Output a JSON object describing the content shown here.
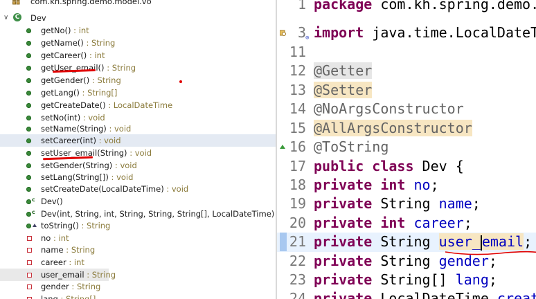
{
  "outline": {
    "items": [
      {
        "label": "com.kh.spring.demo.model.vo",
        "type": "",
        "kind": "package"
      },
      {
        "label": "Dev",
        "type": "",
        "kind": "class"
      },
      {
        "label": "getNo()",
        "type": "int",
        "kind": "method"
      },
      {
        "label": "getName()",
        "type": "String",
        "kind": "method"
      },
      {
        "label": "getCareer()",
        "type": "int",
        "kind": "method"
      },
      {
        "label": "getUser_email()",
        "type": "String",
        "kind": "method"
      },
      {
        "label": "getGender()",
        "type": "String",
        "kind": "method"
      },
      {
        "label": "getLang()",
        "type": "String[]",
        "kind": "method"
      },
      {
        "label": "getCreateDate()",
        "type": "LocalDateTime",
        "kind": "method"
      },
      {
        "label": "setNo(int)",
        "type": "void",
        "kind": "method"
      },
      {
        "label": "setName(String)",
        "type": "void",
        "kind": "method"
      },
      {
        "label": "setCareer(int)",
        "type": "void",
        "kind": "method"
      },
      {
        "label": "setUser_email(String)",
        "type": "void",
        "kind": "method"
      },
      {
        "label": "setGender(String)",
        "type": "void",
        "kind": "method"
      },
      {
        "label": "setLang(String[])",
        "type": "void",
        "kind": "method"
      },
      {
        "label": "setCreateDate(LocalDateTime)",
        "type": "void",
        "kind": "method"
      },
      {
        "label": "Dev()",
        "type": "",
        "kind": "constructor"
      },
      {
        "label": "Dev(int, String, int, String, String, String[], LocalDateTime)",
        "type": "",
        "kind": "constructor"
      },
      {
        "label": "toString()",
        "type": "String",
        "kind": "override"
      },
      {
        "label": "no",
        "type": "int",
        "kind": "field"
      },
      {
        "label": "name",
        "type": "String",
        "kind": "field"
      },
      {
        "label": "career",
        "type": "int",
        "kind": "field"
      },
      {
        "label": "user_email",
        "type": "String",
        "kind": "field"
      },
      {
        "label": "gender",
        "type": "String",
        "kind": "field"
      },
      {
        "label": "lang",
        "type": "String[]",
        "kind": "field"
      }
    ]
  },
  "editor": {
    "lines": [
      {
        "num": "1",
        "text": "package com.kh.spring.demo.model.vo;"
      },
      {
        "num": "3",
        "text": "import java.time.LocalDateTime;"
      },
      {
        "num": "11",
        "text": ""
      },
      {
        "num": "12",
        "text": "@Getter"
      },
      {
        "num": "13",
        "text": "@Setter"
      },
      {
        "num": "14",
        "text": "@NoArgsConstructor"
      },
      {
        "num": "15",
        "text": "@AllArgsConstructor"
      },
      {
        "num": "16",
        "text": "@ToString"
      },
      {
        "num": "17",
        "text": "public class Dev {"
      },
      {
        "num": "18",
        "text": "private int no;"
      },
      {
        "num": "19",
        "text": "private String name;"
      },
      {
        "num": "20",
        "text": "private int career;"
      },
      {
        "num": "21",
        "text": "private String user_email;"
      },
      {
        "num": "22",
        "text": "private String gender;"
      },
      {
        "num": "23",
        "text": "private String[] lang;"
      },
      {
        "num": "24",
        "text": "private LocalDateTime createDate;"
      }
    ]
  },
  "colors": {
    "keyword": "#7f0055",
    "annotation": "#646464",
    "field": "#0000c0",
    "selection": "#e4eaf3",
    "annotation_highlight": "#f7e6c2",
    "pen": "#e00000"
  }
}
